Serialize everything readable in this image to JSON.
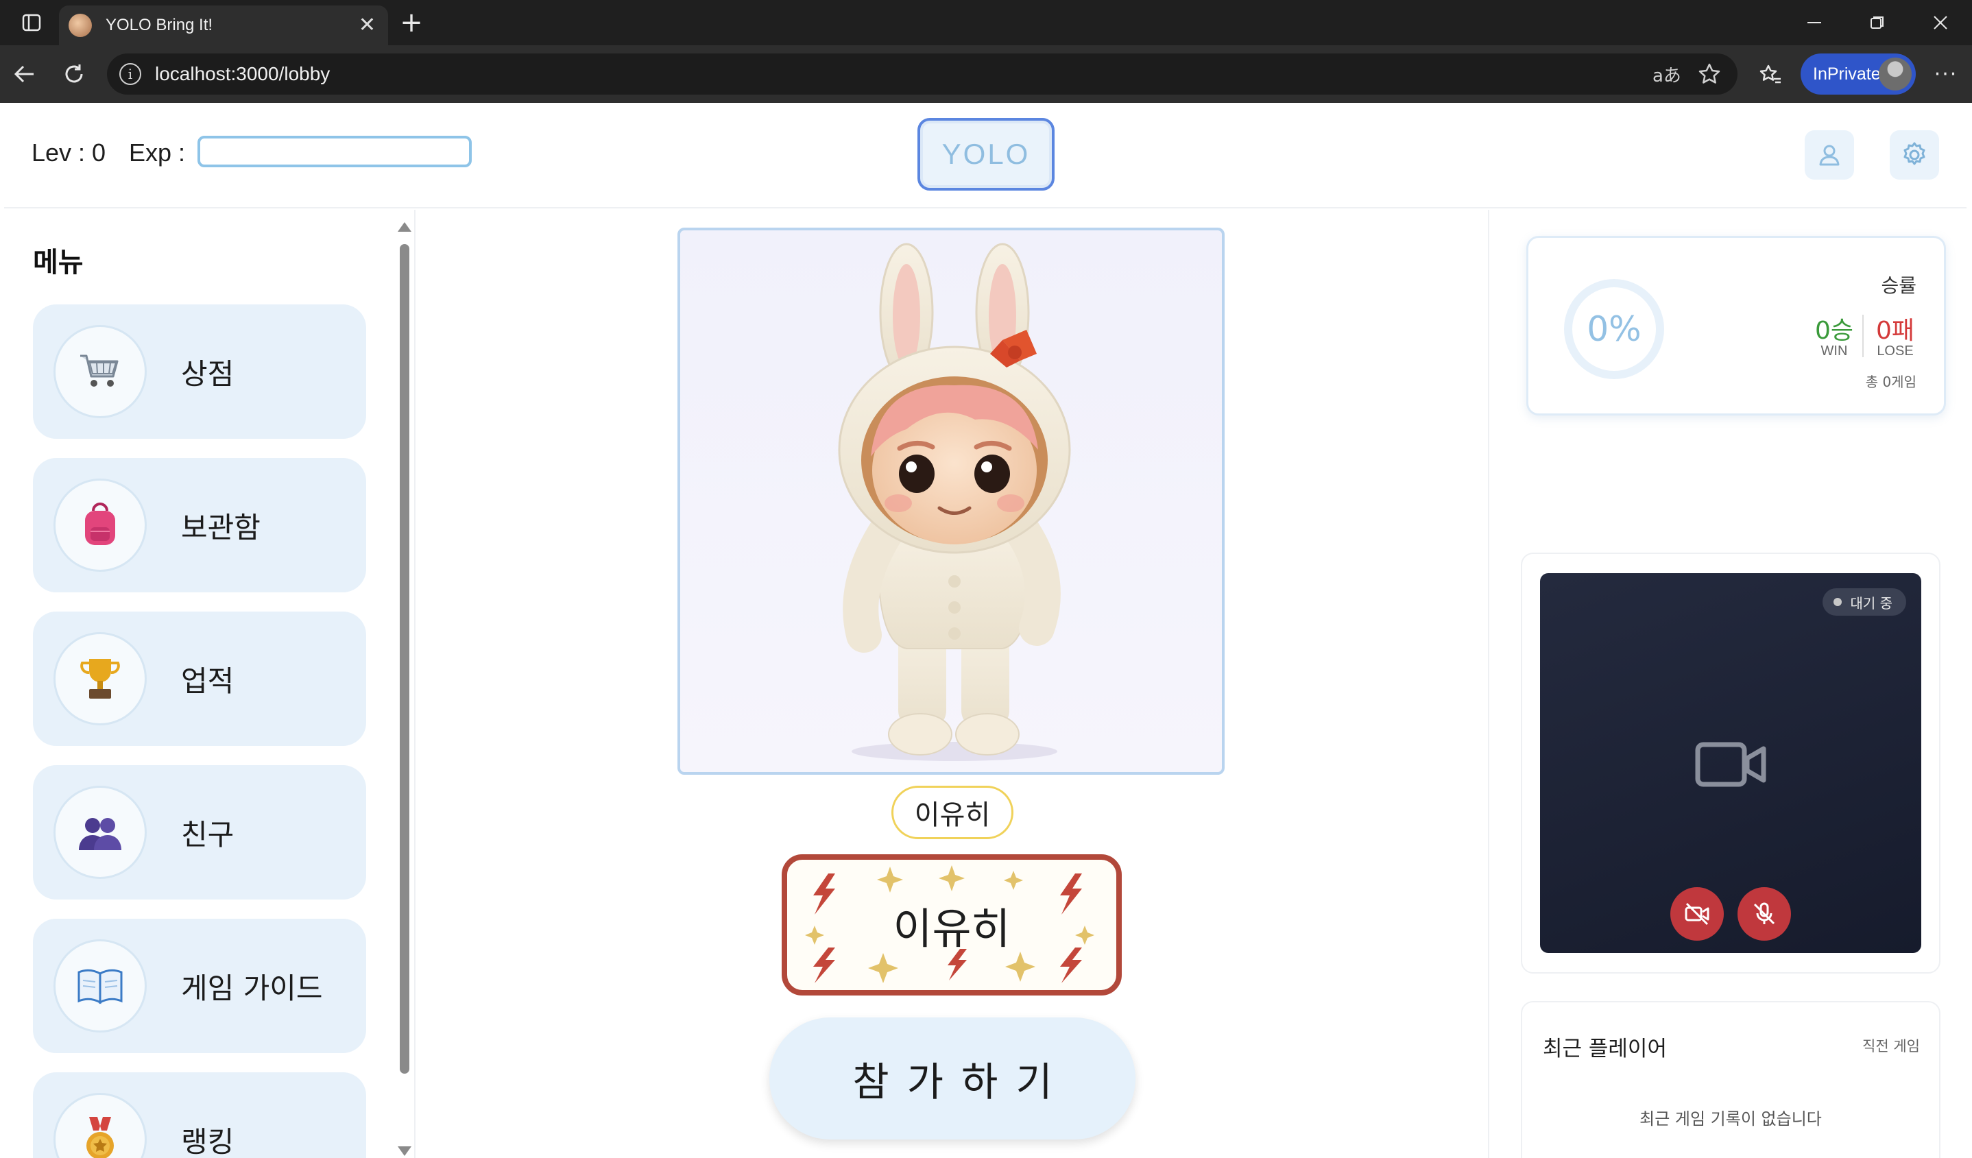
{
  "browser": {
    "tab_title": "YOLO Bring It!",
    "url": "localhost:3000/lobby",
    "inprivate_label": "InPrivate"
  },
  "header": {
    "level_text": "Lev : 0",
    "exp_label": "Exp :",
    "exp_progress": 0,
    "logo_button": "YOLO"
  },
  "sidebar": {
    "title": "메뉴",
    "items": [
      {
        "label": "상점",
        "icon": "cart-icon"
      },
      {
        "label": "보관함",
        "icon": "backpack-icon"
      },
      {
        "label": "업적",
        "icon": "trophy-icon"
      },
      {
        "label": "친구",
        "icon": "friends-icon"
      },
      {
        "label": "게임 가이드",
        "icon": "book-icon"
      },
      {
        "label": "랭킹",
        "icon": "medal-icon"
      }
    ]
  },
  "character": {
    "nickname_pill": "이유히",
    "nameplate_text": "이유히",
    "join_button": "참가하기"
  },
  "stats": {
    "win_rate": "0%",
    "win_rate_label": "승률",
    "wins": "0승",
    "wins_label": "WIN",
    "losses": "0패",
    "losses_label": "LOSE",
    "total": "총 0게임"
  },
  "video": {
    "status": "대기 중"
  },
  "recent": {
    "title": "최근 플레이어",
    "link": "직전 게임",
    "empty": "최근 게임 기록이 없습니다"
  },
  "colors": {
    "accent_blue": "#8ec4e8",
    "menu_bg": "#e7f1fa",
    "win_green": "#3a9a3a",
    "lose_red": "#d43a3a",
    "nameplate_border": "#b2483a",
    "video_bg": "#1c2236",
    "control_red": "#c0383d"
  }
}
